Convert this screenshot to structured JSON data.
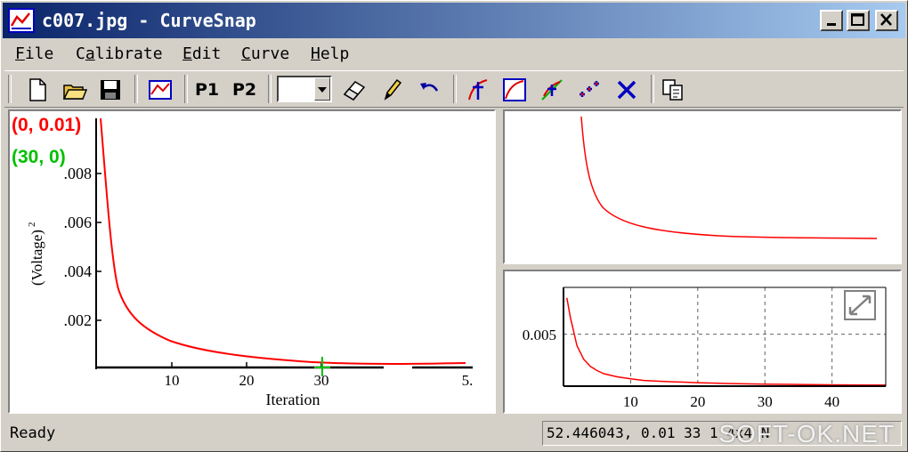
{
  "window": {
    "title": "c007.jpg - CurveSnap",
    "minimize_label": "_",
    "maximize_label": "□",
    "close_label": "✕"
  },
  "menu": {
    "items": [
      {
        "accel": "F",
        "rest": "ile"
      },
      {
        "accel": "",
        "pre": "C",
        "accel2": "a",
        "rest": "librate"
      },
      {
        "accel": "E",
        "rest": "dit"
      },
      {
        "accel": "C",
        "rest": "urve"
      },
      {
        "accel": "H",
        "rest": "elp"
      }
    ]
  },
  "toolbar": {
    "p1_label": "P1",
    "p2_label": "P2",
    "p1_color": "#ff0000",
    "p2_color": "#00c000",
    "icons": [
      "new-file-icon",
      "open-folder-icon",
      "save-icon",
      "chart-icon",
      "color-dropdown",
      "eraser-icon",
      "pencil-icon",
      "undo-icon",
      "add-point-icon",
      "draw-curve-icon",
      "move-point-icon",
      "auto-trace-icon",
      "delete-point-icon",
      "copy-icon"
    ]
  },
  "main_plot": {
    "calib_p1": "(0, 0.01)",
    "calib_p2": "(30, 0)",
    "y_tick_labels": [
      ".008",
      ".006",
      ".004",
      ".002"
    ],
    "x_tick_labels": [
      "10",
      "20",
      "30",
      "5."
    ],
    "xlabel": "Iteration",
    "ylabel": "(Voltage)",
    "ylabel_sup": "2",
    "curve_color": "#ff0000"
  },
  "preview_plot": {
    "y_tick_label": "0.005",
    "x_tick_labels": [
      "10",
      "20",
      "30",
      "40"
    ],
    "chart_data": {
      "type": "line",
      "x": [
        0.5,
        1,
        2,
        3,
        4,
        5,
        6,
        8,
        10,
        12,
        15,
        20,
        25,
        30,
        35,
        40,
        45,
        48
      ],
      "y": [
        0.0085,
        0.0067,
        0.0039,
        0.0026,
        0.0019,
        0.0015,
        0.0012,
        0.0009,
        0.0007,
        0.00055,
        0.00045,
        0.00033,
        0.00025,
        0.0002,
        0.00016,
        0.00013,
        0.00011,
        0.0001
      ],
      "xlim": [
        0,
        48
      ],
      "ylim": [
        0,
        0.0095
      ],
      "grid": true
    },
    "expand_icon": "expand-icon"
  },
  "status": {
    "text": "Ready",
    "coords": "52.446043,  0.01 33  1 4x4 N",
    "watermark": "SOFT-OK.NET"
  }
}
